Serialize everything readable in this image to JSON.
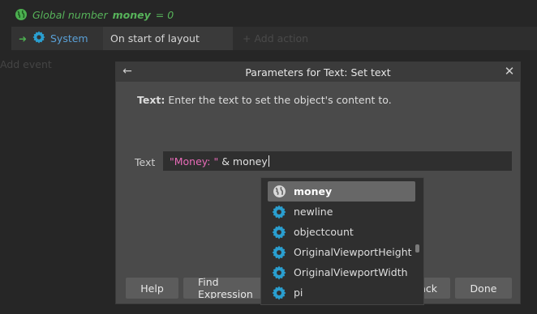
{
  "event_sheet": {
    "global_var": {
      "prefix": "Global number",
      "name": "money",
      "suffix": "= 0"
    },
    "event": {
      "condition_object": "System",
      "trigger": "On start of layout",
      "add_action": "+ Add action"
    },
    "add_event": "Add event"
  },
  "dialog": {
    "title": "Parameters for Text: Set text",
    "param_name": "Text:",
    "param_description": "Enter the text to set the object's content to.",
    "field_label": "Text",
    "field_value_string": "\"Money: \"",
    "field_value_rest": " & money",
    "buttons": {
      "help": "Help",
      "find": "Find Expression",
      "back": "Back",
      "done": "Done"
    }
  },
  "autocomplete": {
    "items": [
      {
        "label": "money",
        "icon": "globe-icon",
        "selected": true
      },
      {
        "label": "newline",
        "icon": "gear-icon",
        "selected": false
      },
      {
        "label": "objectcount",
        "icon": "gear-icon",
        "selected": false
      },
      {
        "label": "OriginalViewportHeight",
        "icon": "gear-icon",
        "selected": false
      },
      {
        "label": "OriginalViewportWidth",
        "icon": "gear-icon",
        "selected": false
      },
      {
        "label": "pi",
        "icon": "gear-icon",
        "selected": false
      }
    ]
  },
  "colors": {
    "global_green": "#57b35a",
    "system_blue": "#5aa0d6",
    "string_pink": "#e86bb8",
    "gear_teal": "#2a9fd0"
  }
}
